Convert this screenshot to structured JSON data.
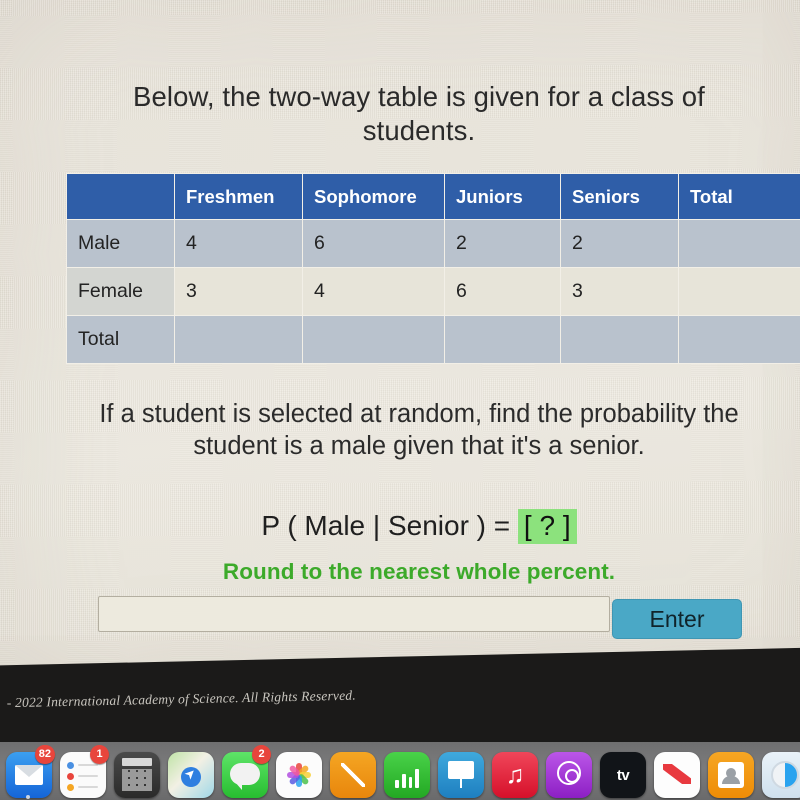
{
  "prompt": {
    "text": "Below, the two-way table is given for a class of students."
  },
  "table": {
    "corner_label": "",
    "columns": [
      "Freshmen",
      "Sophomore",
      "Juniors",
      "Seniors",
      "Total"
    ],
    "rows": [
      {
        "label": "Male",
        "values": [
          "4",
          "6",
          "2",
          "2",
          ""
        ]
      },
      {
        "label": "Female",
        "values": [
          "3",
          "4",
          "6",
          "3",
          ""
        ]
      },
      {
        "label": "Total",
        "values": [
          "",
          "",
          "",
          "",
          ""
        ]
      }
    ],
    "header_color": "#2f5ea8",
    "shade_color": "#b9c2cd",
    "light_color": "#e7e4d9"
  },
  "question": {
    "text": "If a student is selected at random, find the probability the student is a male given that it's a senior."
  },
  "probability": {
    "expression": "P ( Male | Senior ) =",
    "blank": "[ ? ]",
    "blank_highlight": "#8ce27d"
  },
  "rounding_note": {
    "text": "Round to the nearest whole percent.",
    "color": "#3caa2a"
  },
  "answer": {
    "value": "",
    "placeholder": "",
    "enter_label": "Enter",
    "enter_color": "#4aa8c6"
  },
  "footer": {
    "copyright": "- 2022 International Academy of Science.  All Rights Reserved."
  },
  "dock": {
    "items": [
      {
        "name": "mail",
        "badge": "82"
      },
      {
        "name": "reminders",
        "badge": "1"
      },
      {
        "name": "calculator",
        "badge": ""
      },
      {
        "name": "maps",
        "badge": ""
      },
      {
        "name": "messages",
        "badge": "2"
      },
      {
        "name": "photos",
        "badge": ""
      },
      {
        "name": "pages",
        "badge": ""
      },
      {
        "name": "numbers",
        "badge": ""
      },
      {
        "name": "keynote",
        "badge": ""
      },
      {
        "name": "music",
        "badge": ""
      },
      {
        "name": "podcasts",
        "badge": ""
      },
      {
        "name": "apple-tv",
        "badge": ""
      },
      {
        "name": "news",
        "badge": ""
      },
      {
        "name": "contacts",
        "badge": ""
      },
      {
        "name": "safari",
        "badge": ""
      },
      {
        "name": "app-blue",
        "badge": ""
      },
      {
        "name": "app-teal",
        "badge": ""
      }
    ],
    "tv_label": "tv"
  }
}
